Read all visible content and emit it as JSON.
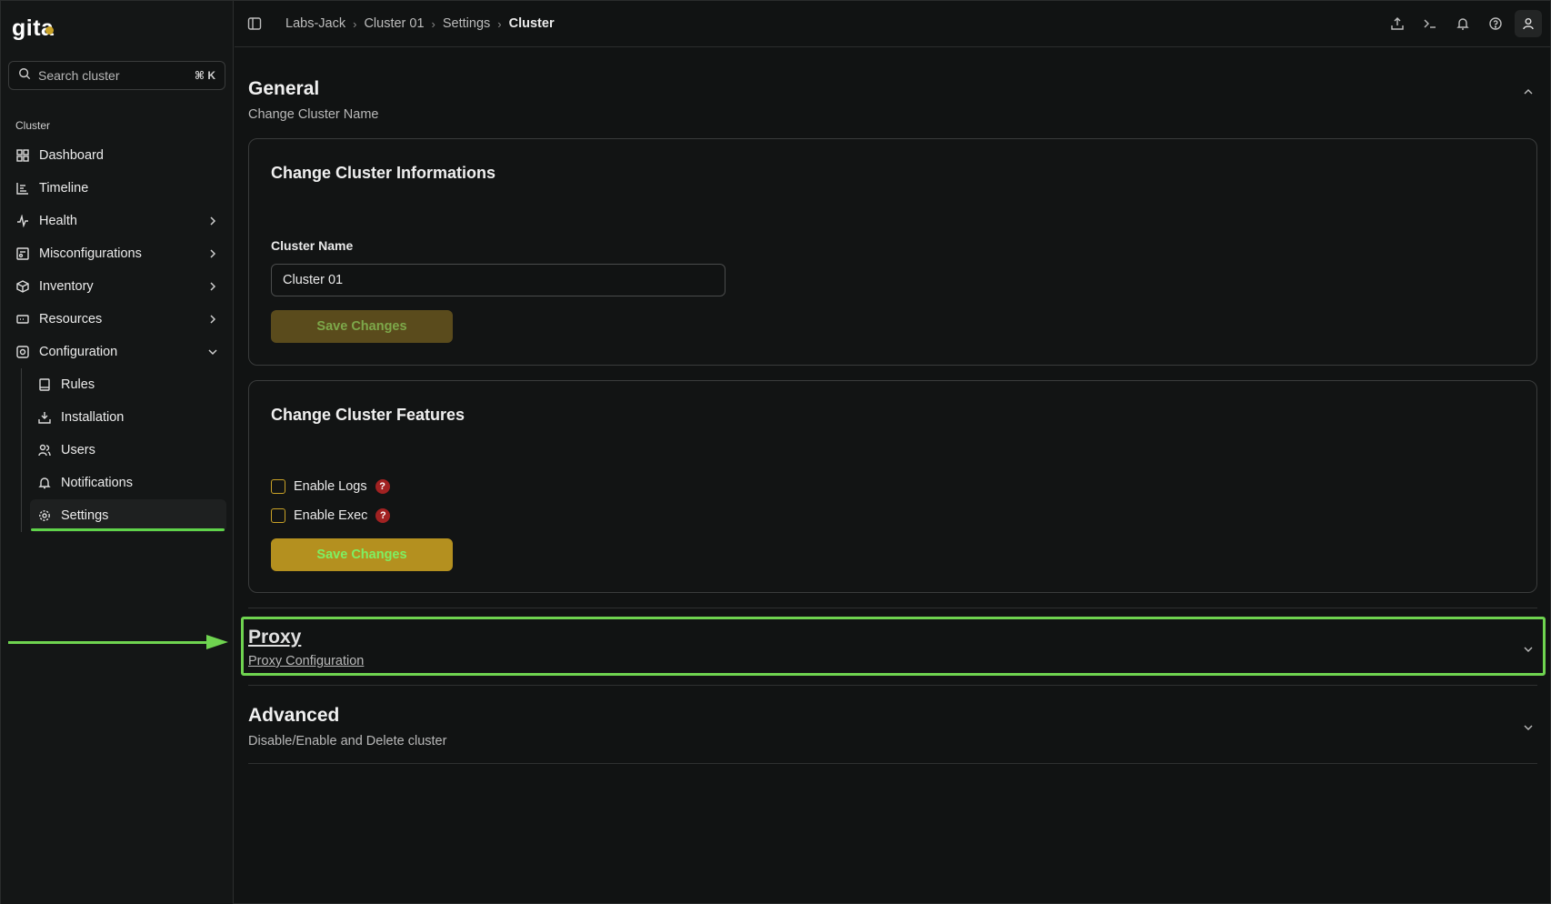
{
  "app": {
    "logo_text": "gita"
  },
  "sidebar": {
    "search_placeholder": "Search cluster",
    "search_shortcut": "⌘ K",
    "section_label": "Cluster",
    "items": [
      {
        "label": "Dashboard",
        "icon": "grid-icon",
        "has_chevron": false
      },
      {
        "label": "Timeline",
        "icon": "timeline-icon",
        "has_chevron": false
      },
      {
        "label": "Health",
        "icon": "pulse-icon",
        "has_chevron": true
      },
      {
        "label": "Misconfigurations",
        "icon": "misconfig-icon",
        "has_chevron": true
      },
      {
        "label": "Inventory",
        "icon": "box-icon",
        "has_chevron": true
      },
      {
        "label": "Resources",
        "icon": "resources-icon",
        "has_chevron": true
      },
      {
        "label": "Configuration",
        "icon": "configuration-icon",
        "expanded": true
      }
    ],
    "sub_items": [
      {
        "label": "Rules",
        "icon": "book-icon"
      },
      {
        "label": "Installation",
        "icon": "install-icon"
      },
      {
        "label": "Users",
        "icon": "users-icon"
      },
      {
        "label": "Notifications",
        "icon": "bell-icon"
      },
      {
        "label": "Settings",
        "icon": "gear-icon",
        "active": true
      }
    ]
  },
  "header": {
    "breadcrumb": [
      "Labs-Jack",
      "Cluster 01",
      "Settings",
      "Cluster"
    ]
  },
  "general": {
    "title": "General",
    "subtitle": "Change Cluster Name",
    "info_card": {
      "title": "Change Cluster Informations",
      "field_label": "Cluster Name",
      "field_value": "Cluster 01",
      "save_label": "Save Changes"
    },
    "features_card": {
      "title": "Change Cluster Features",
      "options": [
        {
          "label": "Enable Logs",
          "checked": false,
          "help": "?"
        },
        {
          "label": "Enable Exec",
          "checked": false,
          "help": "?"
        }
      ],
      "save_label": "Save Changes"
    }
  },
  "proxy": {
    "title": "Proxy",
    "subtitle": "Proxy Configuration"
  },
  "advanced": {
    "title": "Advanced",
    "subtitle": "Disable/Enable and Delete cluster"
  },
  "colors": {
    "accent": "#c9a227",
    "highlight": "#6fd450",
    "help": "#a12222"
  }
}
